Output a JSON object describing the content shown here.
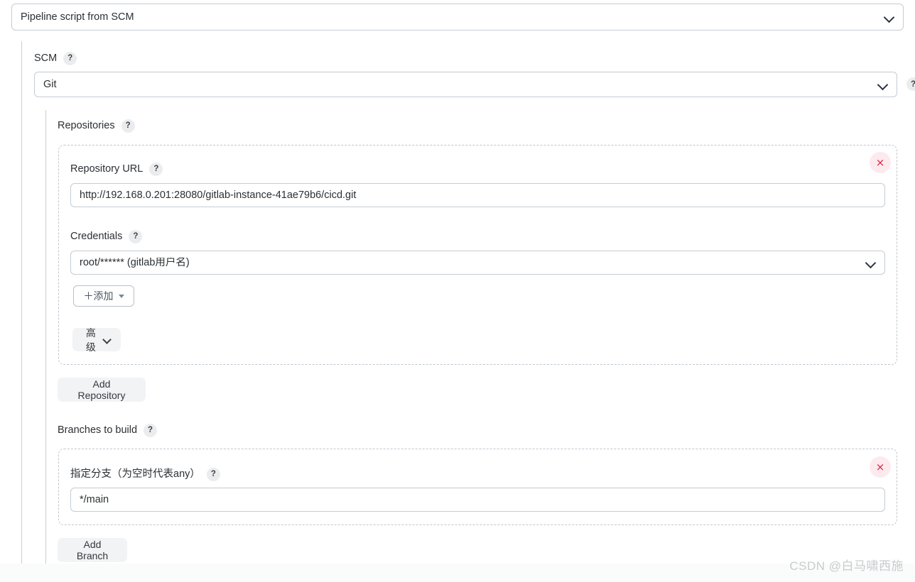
{
  "definition": {
    "selected": "Pipeline script from SCM",
    "chevron_icon": "chevron-down-icon"
  },
  "scm": {
    "label": "SCM",
    "help": "?",
    "selected": "Git",
    "edge_help": "?"
  },
  "repositories": {
    "label": "Repositories",
    "help": "?",
    "delete_icon": "×",
    "repository_url": {
      "label": "Repository URL",
      "help": "?",
      "value": "http://192.168.0.201:28080/gitlab-instance-41ae79b6/cicd.git",
      "placeholder": ""
    },
    "credentials": {
      "label": "Credentials",
      "help": "?",
      "value": "root/****** (gitlab用户名)"
    },
    "add_credential_button": {
      "label": "＋添加",
      "caret_icon": "caret-down-icon"
    },
    "advanced_button": {
      "label": "高级",
      "chevron_icon": "chevron-down-icon"
    },
    "add_repository_button": "Add Repository"
  },
  "branches": {
    "label": "Branches to build",
    "help": "?",
    "delete_icon": "×",
    "branch_spec": {
      "label": "指定分支（为空时代表any）",
      "help": "?",
      "value": "*/main",
      "placeholder": ""
    },
    "add_branch_button": "Add Branch"
  },
  "watermark": "CSDN @白马啸西施",
  "colors": {
    "border": "#c4ccd3",
    "dashed": "#bfc7ce",
    "danger_bg": "#fdeaee",
    "danger_fg": "#d6243f",
    "pill_bg": "#f2f3f5"
  }
}
